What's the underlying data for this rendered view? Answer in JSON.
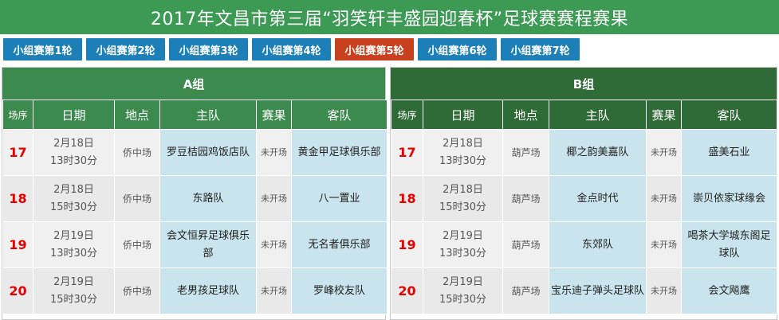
{
  "title": "2017年文昌市第三届“羽笑轩丰盛园迎春杯”足球赛赛程赛果",
  "tabs": [
    {
      "label": "小组赛第1轮"
    },
    {
      "label": "小组赛第2轮"
    },
    {
      "label": "小组赛第3轮"
    },
    {
      "label": "小组赛第4轮"
    },
    {
      "label": "小组赛第5轮"
    },
    {
      "label": "小组赛第6轮"
    },
    {
      "label": "小组赛第7轮"
    }
  ],
  "active_tab": "小组赛第5轮",
  "columns": {
    "index": "场序",
    "date": "日期",
    "venue": "地点",
    "home": "主队",
    "result": "赛果",
    "away": "客队"
  },
  "groups": [
    {
      "name": "A组",
      "matches": [
        {
          "no": "17",
          "date": "2月18日",
          "time": "13时30分",
          "venue": "侨中场",
          "home": "罗豆桔园鸡饭店队",
          "result": "未开场",
          "away": "黄金甲足球俱乐部"
        },
        {
          "no": "18",
          "date": "2月18日",
          "time": "15时30分",
          "venue": "侨中场",
          "home": "东路队",
          "result": "未开场",
          "away": "八一置业"
        },
        {
          "no": "19",
          "date": "2月19日",
          "time": "13时30分",
          "venue": "侨中场",
          "home": "会文恒昇足球俱乐部",
          "result": "未开场",
          "away": "无名者俱乐部"
        },
        {
          "no": "20",
          "date": "2月19日",
          "time": "15时30分",
          "venue": "侨中场",
          "home": "老男孩足球队",
          "result": "未开场",
          "away": "罗峰校友队"
        }
      ]
    },
    {
      "name": "B组",
      "matches": [
        {
          "no": "17",
          "date": "2月18日",
          "time": "13时30分",
          "venue": "葫芦场",
          "home": "椰之韵美嘉队",
          "result": "未开场",
          "away": "盛美石业"
        },
        {
          "no": "18",
          "date": "2月18日",
          "time": "15时30分",
          "venue": "葫芦场",
          "home": "金点时代",
          "result": "未开场",
          "away": "崇贝依家球缘会"
        },
        {
          "no": "19",
          "date": "2月19日",
          "time": "13时30分",
          "venue": "葫芦场",
          "home": "东郊队",
          "result": "未开场",
          "away": "喝茶大学城东阁足球队"
        },
        {
          "no": "20",
          "date": "2月19日",
          "time": "15时30分",
          "venue": "葫芦场",
          "home": "宝乐迪子弹头足球队",
          "result": "未开场",
          "away": "会文飚鹰"
        }
      ]
    }
  ],
  "colors": {
    "title_bg": "#3d9a55",
    "tab_bg": "#1d7fb8",
    "tab_active_bg": "#c8401e",
    "group_a_header": "#3d8a4e",
    "group_b_header": "#2f6b36",
    "team_cell_bg": "#c9e4ec",
    "match_number": "#e60000"
  }
}
